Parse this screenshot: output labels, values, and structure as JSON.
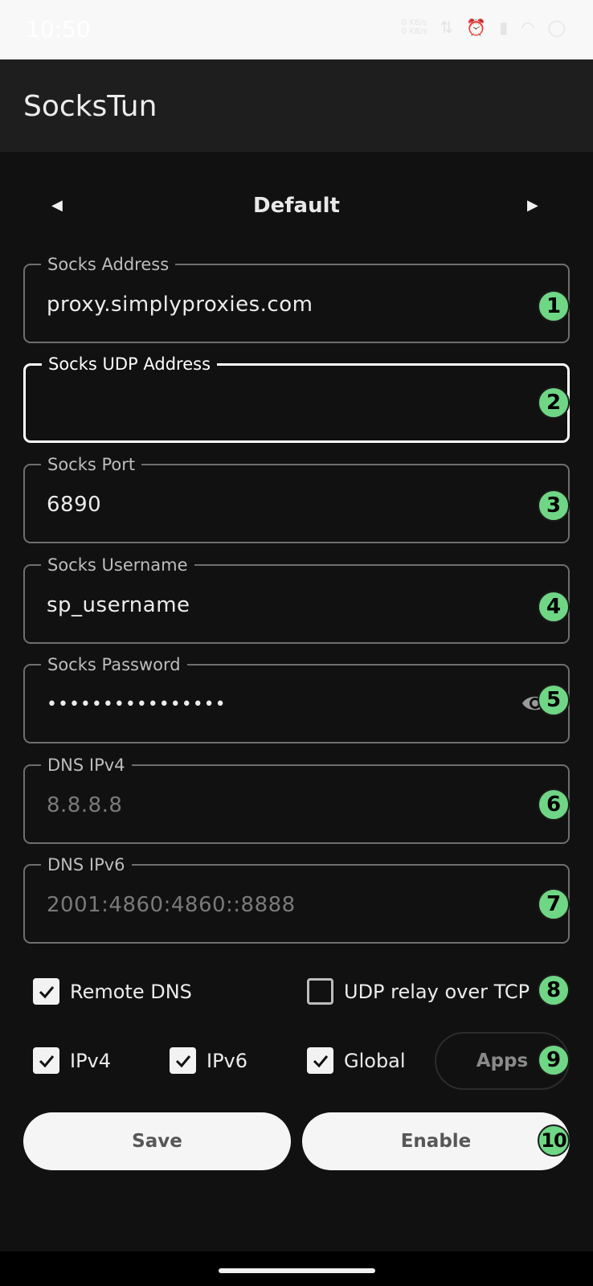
{
  "status_bar": {
    "time": "10:50",
    "net_speed_up": "0 KB/s",
    "net_speed_down": "0 KB/s",
    "icons": [
      "data-transfer-icon",
      "alarm-icon",
      "signal-icon",
      "wifi-icon",
      "battery-icon"
    ]
  },
  "app": {
    "title": "SocksTun"
  },
  "profile": {
    "name": "Default",
    "prev_glyph": "◀",
    "next_glyph": "▶"
  },
  "fields": {
    "socks_address": {
      "label": "Socks Address",
      "value": "proxy.simplyproxies.com",
      "badge": "1"
    },
    "socks_udp_address": {
      "label": "Socks UDP Address",
      "value": "",
      "badge": "2"
    },
    "socks_port": {
      "label": "Socks Port",
      "value": "6890",
      "badge": "3"
    },
    "socks_username": {
      "label": "Socks Username",
      "value": "sp_username",
      "badge": "4"
    },
    "socks_password": {
      "label": "Socks Password",
      "value": "••••••••••••••••",
      "badge": "5"
    },
    "dns_ipv4": {
      "label": "DNS IPv4",
      "placeholder": "8.8.8.8",
      "badge": "6"
    },
    "dns_ipv6": {
      "label": "DNS IPv6",
      "placeholder": "2001:4860:4860::8888",
      "badge": "7"
    }
  },
  "options": {
    "remote_dns": {
      "label": "Remote DNS",
      "checked": true
    },
    "udp_relay": {
      "label": "UDP relay over TCP",
      "checked": false
    },
    "ipv4": {
      "label": "IPv4",
      "checked": true
    },
    "ipv6": {
      "label": "IPv6",
      "checked": true
    },
    "global": {
      "label": "Global",
      "checked": true
    },
    "row1_badge": "8",
    "row2_badge": "9"
  },
  "buttons": {
    "apps": "Apps",
    "save": "Save",
    "enable": "Enable",
    "enable_badge": "10"
  },
  "colors": {
    "badge": "#6fd685",
    "background": "#111111",
    "app_bar": "#1e1e1e",
    "button": "#f5f5f5"
  }
}
